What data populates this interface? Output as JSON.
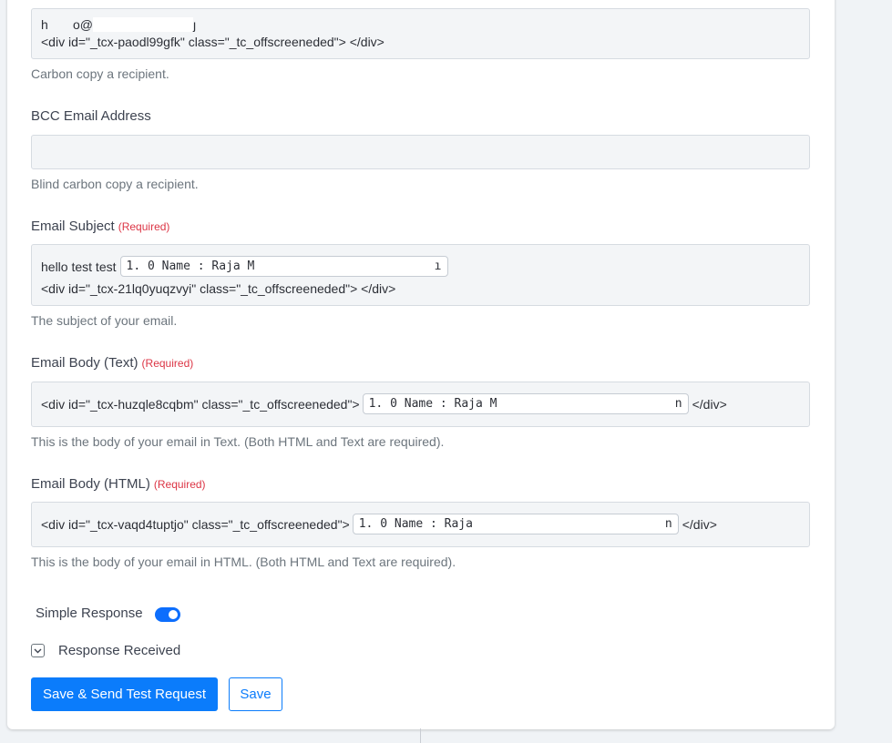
{
  "cc": {
    "value_email": "h       o@",
    "value_code": "<div id=\"_tcx-paodl99gfk\" class=\"_tc_offscreeneded\"> </div>",
    "help": "Carbon copy a recipient."
  },
  "bcc": {
    "label": "BCC Email Address",
    "value": "",
    "help": "Blind carbon copy a recipient."
  },
  "subject": {
    "label": "Email Subject",
    "required": "(Required)",
    "prefix": "hello test test",
    "chip": "1. 0 Name : Raja M",
    "chip_tail": "ı",
    "code": "<div id=\"_tcx-21lq0yuqzvyi\" class=\"_tc_offscreeneded\"> </div>",
    "help": "The subject of your email."
  },
  "body_text": {
    "label": "Email Body (Text)",
    "required": "(Required)",
    "code_open": "<div id=\"_tcx-huzqle8cqbm\" class=\"_tc_offscreeneded\">",
    "chip": "1. 0 Name : Raja M",
    "chip_tail": "n",
    "code_close": "</div>",
    "help": "This is the body of your email in Text. (Both HTML and Text are required)."
  },
  "body_html": {
    "label": "Email Body (HTML)",
    "required": "(Required)",
    "code_open": "<div id=\"_tcx-vaqd4tuptjo\" class=\"_tc_offscreeneded\">",
    "chip": "1. 0 Name : Raja",
    "chip_tail": "n",
    "code_close": "</div>",
    "help": "This is the body of your email in HTML. (Both HTML and Text are required)."
  },
  "simple_response": {
    "label": "Simple Response",
    "on": true
  },
  "response_received": {
    "label": "Response Received"
  },
  "buttons": {
    "save_send": "Save & Send Test Request",
    "save": "Save"
  },
  "colors": {
    "accent": "#0b7cfb",
    "required": "#dc3545"
  }
}
